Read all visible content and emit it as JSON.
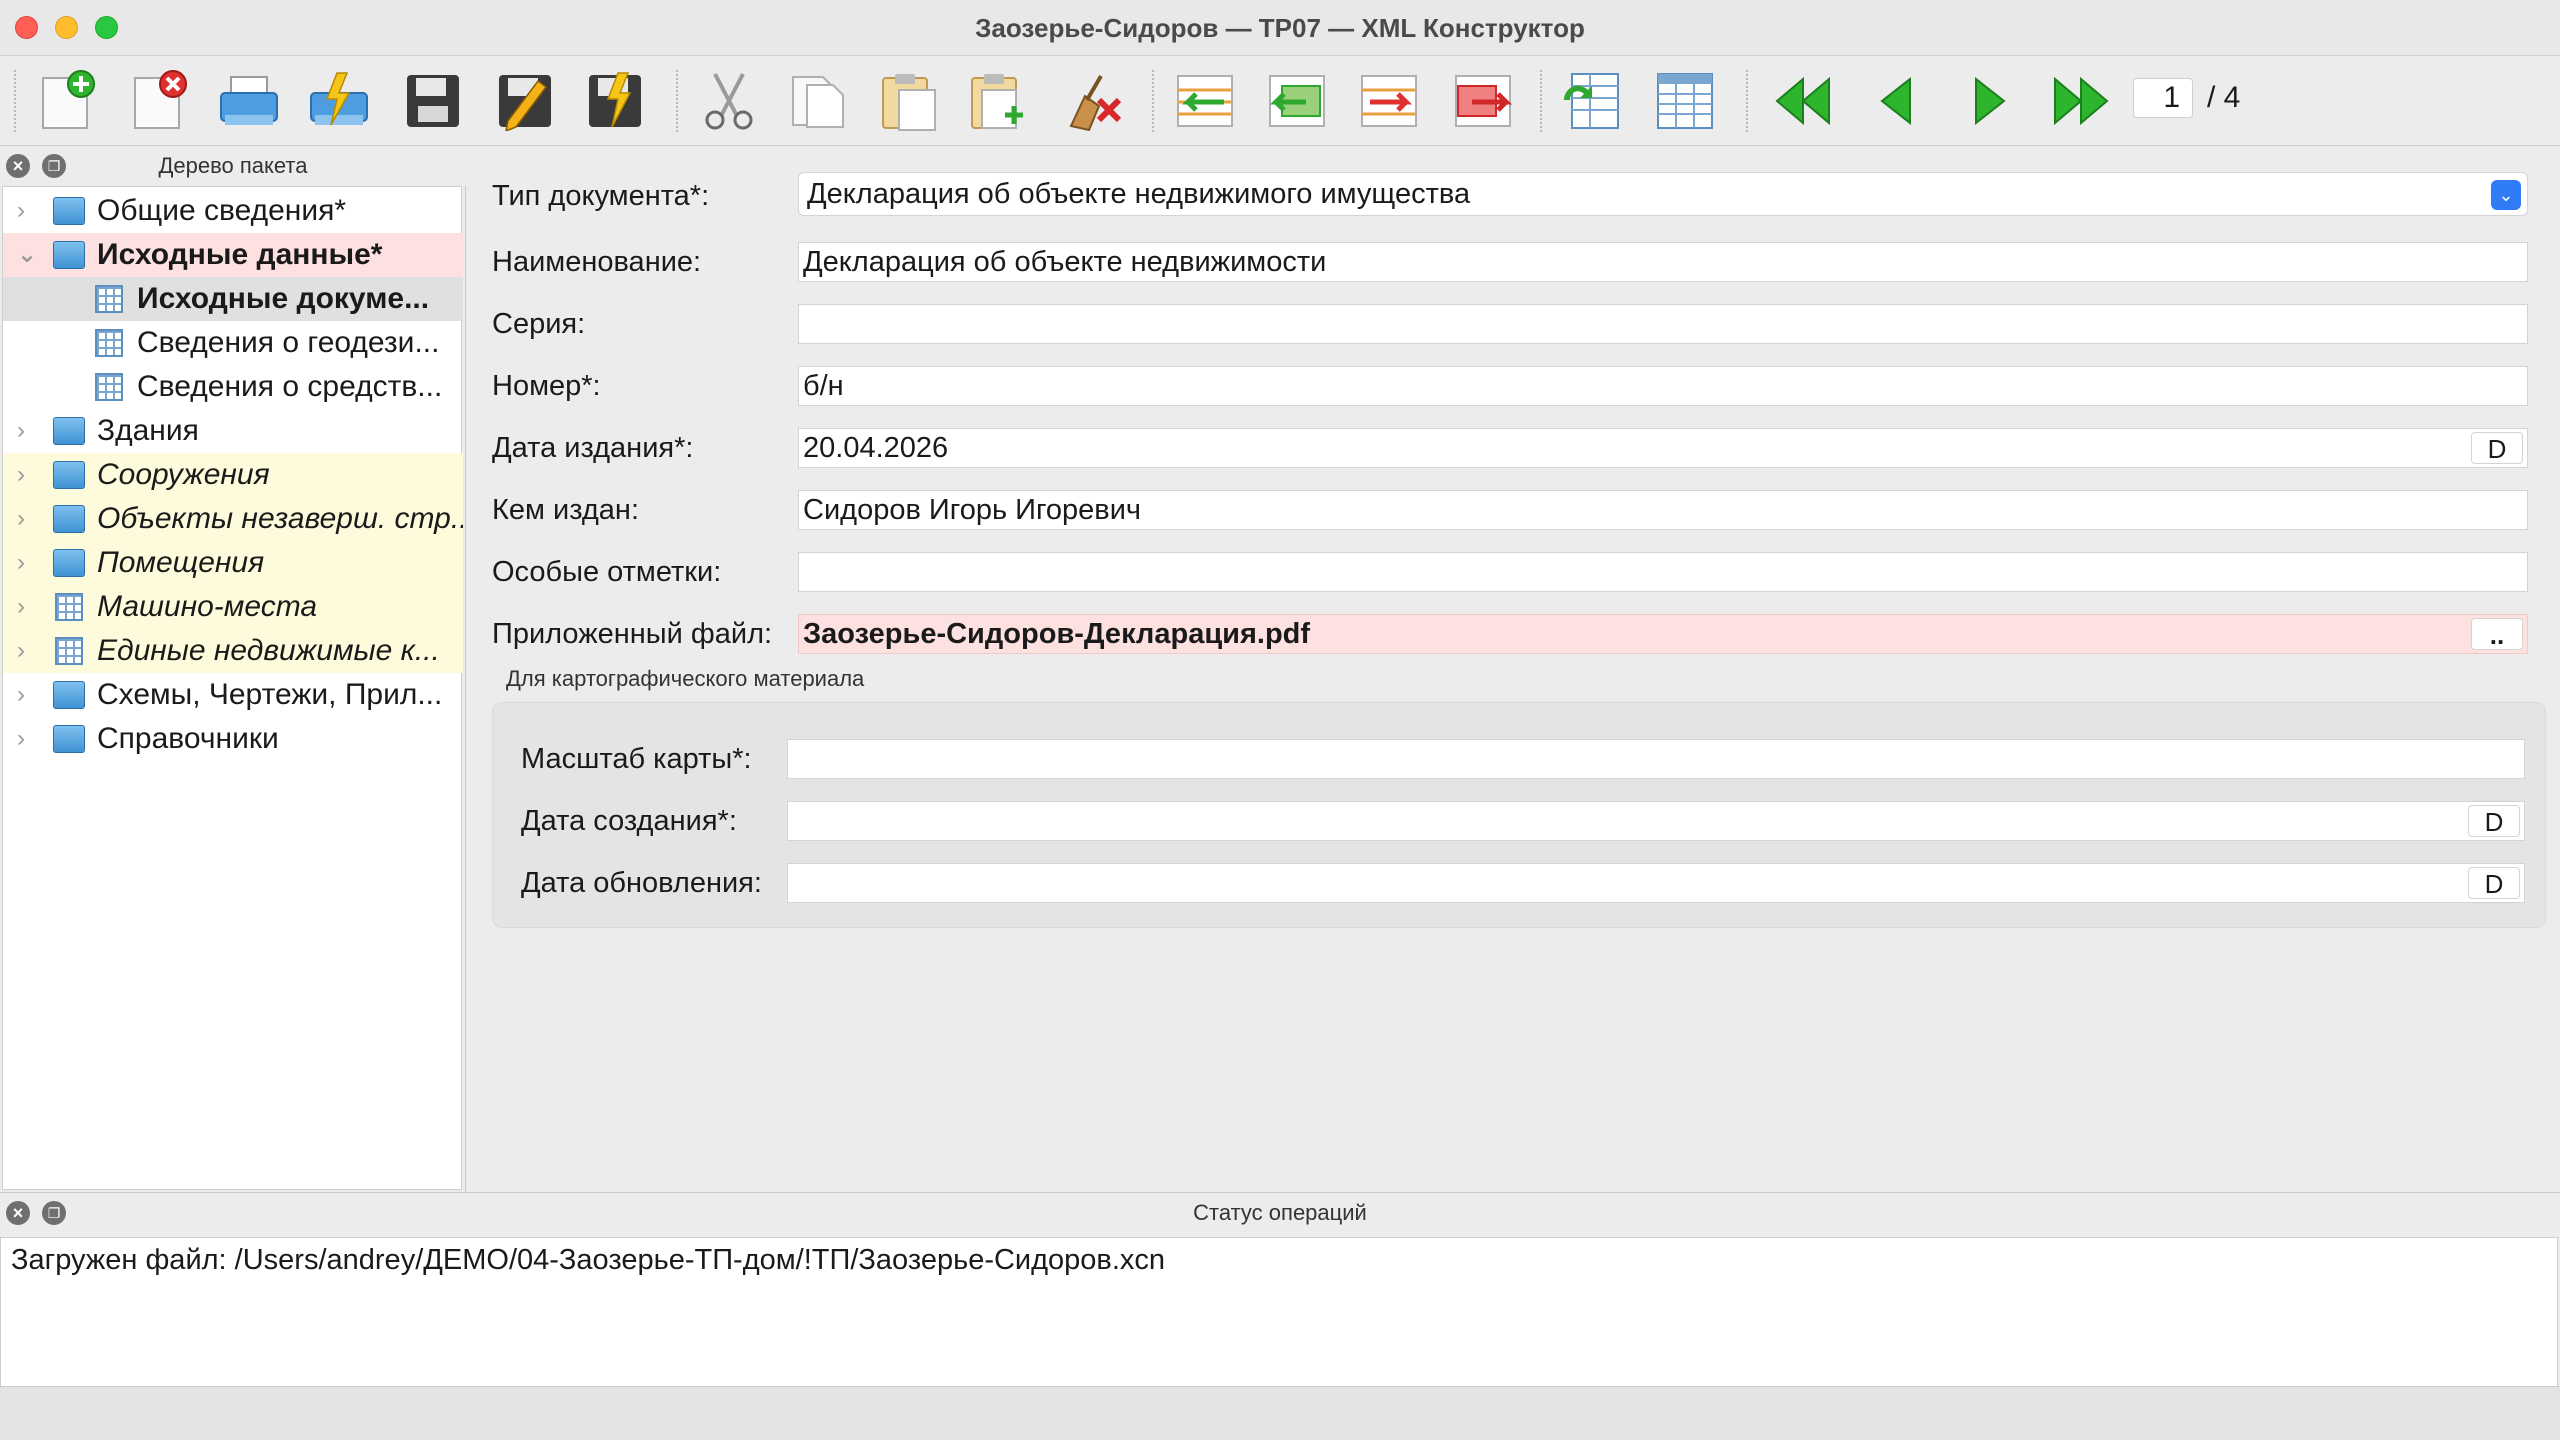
{
  "window": {
    "title": "Заозерье-Сидоров — ТР07 — XML Конструктор"
  },
  "toolbar": {
    "buttons": [
      {
        "name": "new-document-icon"
      },
      {
        "name": "delete-document-icon"
      },
      {
        "name": "print-icon"
      },
      {
        "name": "print-lightning-icon"
      },
      {
        "name": "save-icon"
      },
      {
        "name": "save-as-pencil-icon"
      },
      {
        "name": "save-lightning-icon"
      },
      {
        "name": "cut-icon"
      },
      {
        "name": "copy-icon"
      },
      {
        "name": "paste-icon"
      },
      {
        "name": "paste-add-icon"
      },
      {
        "name": "clear-broom-icon"
      },
      {
        "name": "row-move-left-icon"
      },
      {
        "name": "row-insert-left-icon"
      },
      {
        "name": "row-move-right-icon"
      },
      {
        "name": "row-insert-right-icon"
      },
      {
        "name": "table-refresh-icon"
      },
      {
        "name": "table-columns-icon"
      },
      {
        "name": "first-page-icon"
      },
      {
        "name": "prev-page-icon"
      },
      {
        "name": "next-page-icon"
      },
      {
        "name": "last-page-icon"
      }
    ],
    "page_current": "1",
    "page_total": "/ 4"
  },
  "left_panel": {
    "caption": "Дерево пакета",
    "items": [
      {
        "label": "Общие сведения*",
        "level": 0,
        "icon": "folder-icon",
        "style": "normal"
      },
      {
        "label": "Исходные данные*",
        "level": 0,
        "icon": "folder-icon",
        "style": "bold-pink",
        "expanded": true
      },
      {
        "label": "Исходные докуме...",
        "level": 1,
        "icon": "grid-icon",
        "style": "bold-selected"
      },
      {
        "label": "Сведения о геодези...",
        "level": 1,
        "icon": "grid-icon",
        "style": "normal"
      },
      {
        "label": "Сведения о средств...",
        "level": 1,
        "icon": "grid-icon",
        "style": "normal"
      },
      {
        "label": "Здания",
        "level": 0,
        "icon": "folder-icon",
        "style": "normal"
      },
      {
        "label": "Сооружения",
        "level": 0,
        "icon": "folder-icon",
        "style": "italic-yellow"
      },
      {
        "label": "Объекты незаверш. стр...",
        "level": 0,
        "icon": "folder-icon",
        "style": "italic-yellow"
      },
      {
        "label": "Помещения",
        "level": 0,
        "icon": "folder-icon",
        "style": "italic-yellow"
      },
      {
        "label": "Машино-места",
        "level": 0,
        "icon": "grid-icon",
        "style": "italic-yellow"
      },
      {
        "label": "Единые недвижимые к...",
        "level": 0,
        "icon": "grid-icon",
        "style": "italic-yellow"
      },
      {
        "label": "Схемы, Чертежи, Прил...",
        "level": 0,
        "icon": "folder-icon",
        "style": "normal"
      },
      {
        "label": "Справочники",
        "level": 0,
        "icon": "folder-icon",
        "style": "normal"
      }
    ]
  },
  "form": {
    "doc_type_label": "Тип документа*:",
    "doc_type_value": "Декларация об объекте недвижимого имущества",
    "name_label": "Наименование:",
    "name_value": "Декларация об объекте недвижимости",
    "series_label": "Серия:",
    "series_value": "",
    "number_label": "Номер*:",
    "number_value": "б/н",
    "issue_date_label": "Дата издания*:",
    "issue_date_value": "20.04.2026",
    "issued_by_label": "Кем издан:",
    "issued_by_value": "Сидоров Игорь Игоревич",
    "notes_label": "Особые отметки:",
    "notes_value": "",
    "attached_label": "Приложенный файл:",
    "attached_value": "Заозерье-Сидоров-Декларация.pdf",
    "date_button": "D",
    "browse_button": ".."
  },
  "carto_group": {
    "title": "Для картографического материала",
    "scale_label": "Масштаб карты*:",
    "scale_value": "",
    "created_label": "Дата создания*:",
    "created_value": "",
    "updated_label": "Дата обновления:",
    "updated_value": ""
  },
  "status_panel": {
    "caption": "Статус операций",
    "message": "Загружен файл: /Users/andrey/ДЕМО/04-Заозерье-ТП-дом/!ТП/Заозерье-Сидоров.xcn"
  }
}
